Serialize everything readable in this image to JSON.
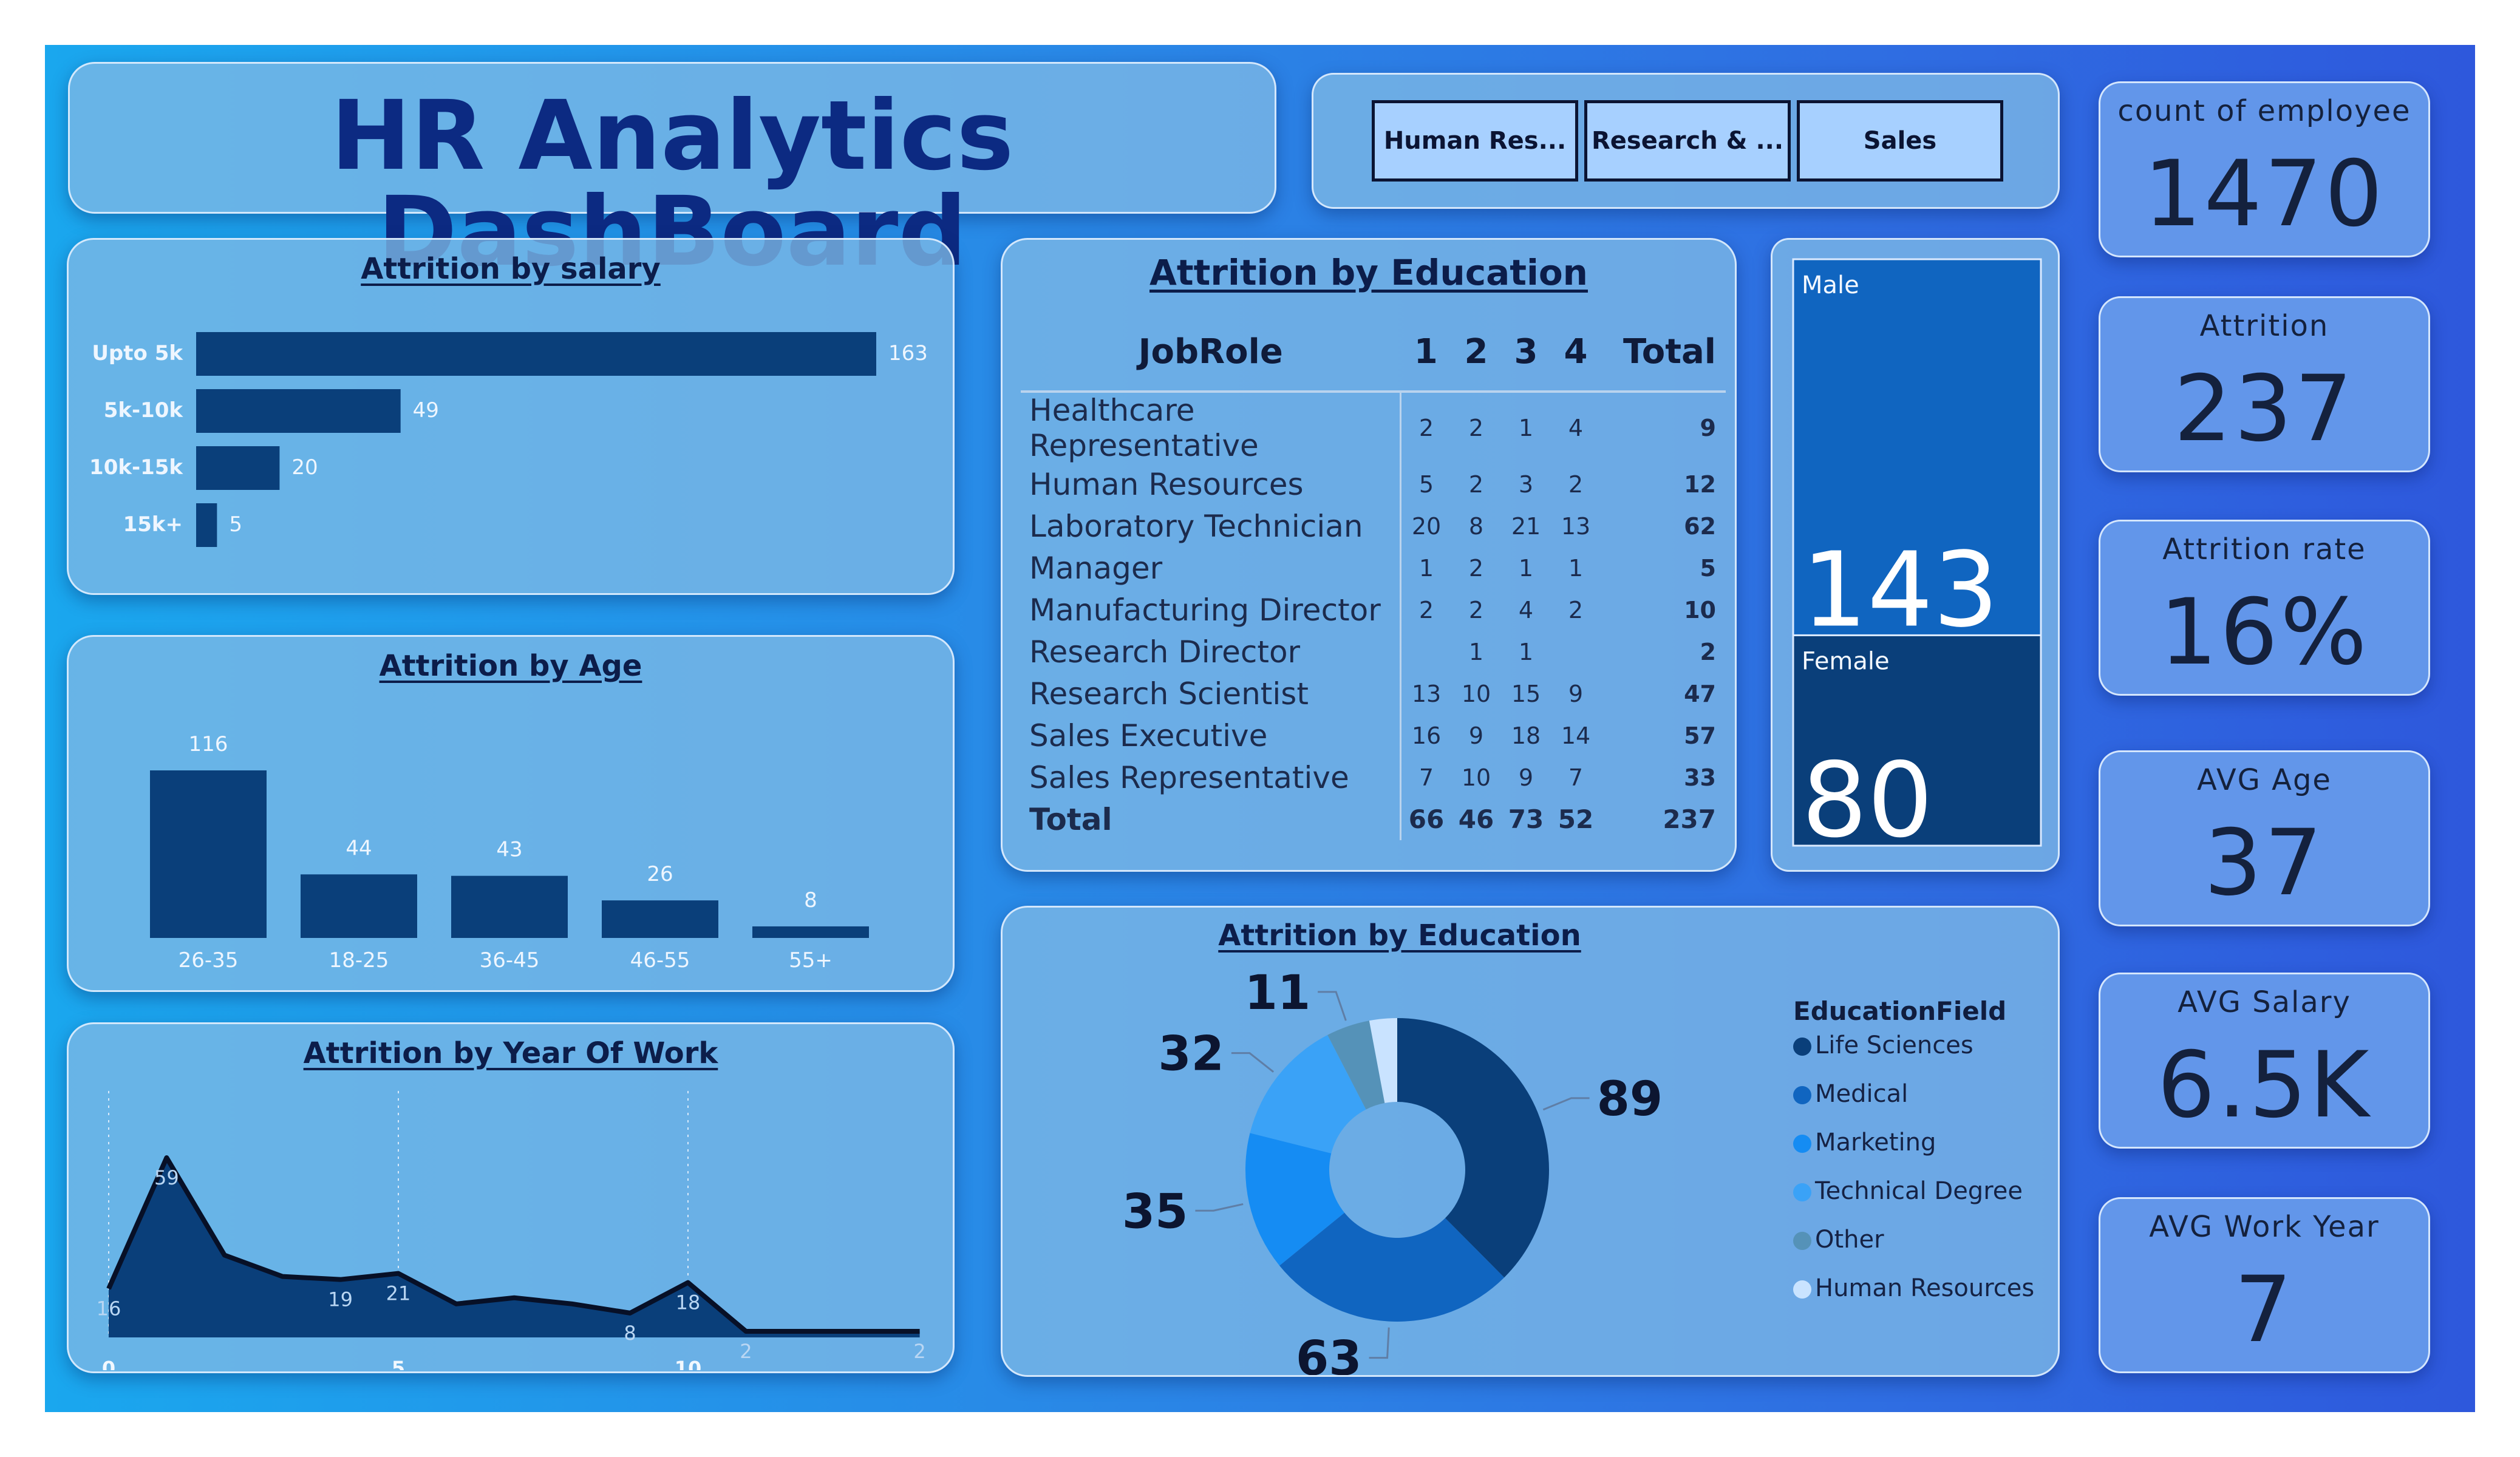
{
  "title": "HR Analytics DashBoard",
  "slicer": {
    "options": [
      "Human Res...",
      "Research & ...",
      "Sales"
    ]
  },
  "kpis": [
    {
      "label": "count of employee",
      "value": "1470"
    },
    {
      "label": "Attrition",
      "value": "237"
    },
    {
      "label": "Attrition rate",
      "value": "16%"
    },
    {
      "label": "AVG Age",
      "value": "37"
    },
    {
      "label": "AVG Salary",
      "value": "6.5K"
    },
    {
      "label": "AVG Work Year",
      "value": "7"
    }
  ],
  "salary_chart": {
    "title": "Attrition by salary",
    "chart_data": {
      "type": "bar",
      "orientation": "horizontal",
      "categories": [
        "Upto 5k",
        "5k-10k",
        "10k-15k",
        "15k+"
      ],
      "values": [
        163,
        49,
        20,
        5
      ],
      "title": "Attrition by salary"
    }
  },
  "age_chart": {
    "title": "Attrition by Age",
    "chart_data": {
      "type": "bar",
      "categories": [
        "26-35",
        "18-25",
        "36-45",
        "46-55",
        "55+"
      ],
      "values": [
        116,
        44,
        43,
        26,
        8
      ],
      "title": "Attrition by Age"
    }
  },
  "year_chart": {
    "title": "Attrition by Year Of Work",
    "chart_data": {
      "type": "area",
      "x": [
        0,
        1,
        2,
        3,
        4,
        5,
        6,
        7,
        8,
        9,
        10,
        11,
        12,
        13,
        14
      ],
      "values": [
        16,
        59,
        27,
        20,
        19,
        21,
        11,
        13,
        11,
        8,
        18,
        2,
        2,
        2,
        2
      ],
      "point_labels": [
        "16",
        "59",
        "",
        "",
        "19",
        "21",
        "",
        "",
        "",
        "8",
        "18",
        "2",
        "",
        "",
        "2"
      ],
      "x_ticks": [
        "0",
        "5",
        "10"
      ],
      "title": "Attrition by Year Of Work"
    }
  },
  "education_matrix": {
    "title": "Attrition by Education",
    "headers": [
      "JobRole",
      "1",
      "2",
      "3",
      "4",
      "Total"
    ],
    "rows": [
      [
        "Healthcare Representative",
        "2",
        "2",
        "1",
        "4",
        "9"
      ],
      [
        "Human Resources",
        "5",
        "2",
        "3",
        "2",
        "12"
      ],
      [
        "Laboratory Technician",
        "20",
        "8",
        "21",
        "13",
        "62"
      ],
      [
        "Manager",
        "1",
        "2",
        "1",
        "1",
        "5"
      ],
      [
        "Manufacturing Director",
        "2",
        "2",
        "4",
        "2",
        "10"
      ],
      [
        "Research Director",
        "",
        "1",
        "1",
        "",
        "2"
      ],
      [
        "Research Scientist",
        "13",
        "10",
        "15",
        "9",
        "47"
      ],
      [
        "Sales Executive",
        "16",
        "9",
        "18",
        "14",
        "57"
      ],
      [
        "Sales Representative",
        "7",
        "10",
        "9",
        "7",
        "33"
      ]
    ],
    "total_row": [
      "Total",
      "66",
      "46",
      "73",
      "52",
      "237"
    ]
  },
  "gender": {
    "chart_data": {
      "type": "treemap",
      "categories": [
        "Male",
        "Female"
      ],
      "values": [
        143,
        80
      ]
    },
    "labels": [
      "Male",
      "Female"
    ],
    "values": [
      "143",
      "80"
    ],
    "colors": [
      "#1065c0",
      "#0a3f7a"
    ]
  },
  "education_field": {
    "title": "Attrition by Education",
    "legend_title": "EducationField",
    "chart_data": {
      "type": "pie",
      "variant": "donut",
      "categories": [
        "Life Sciences",
        "Medical",
        "Marketing",
        "Technical Degree",
        "Other",
        "Human Resources"
      ],
      "values": [
        89,
        63,
        35,
        32,
        11,
        7
      ],
      "value_labels": [
        "89",
        "63",
        "35",
        "32",
        "11",
        ""
      ],
      "colors": [
        "#0a3f7a",
        "#1065c0",
        "#158cf3",
        "#3aa2f7",
        "#5592b8",
        "#c9e3ff"
      ]
    }
  }
}
